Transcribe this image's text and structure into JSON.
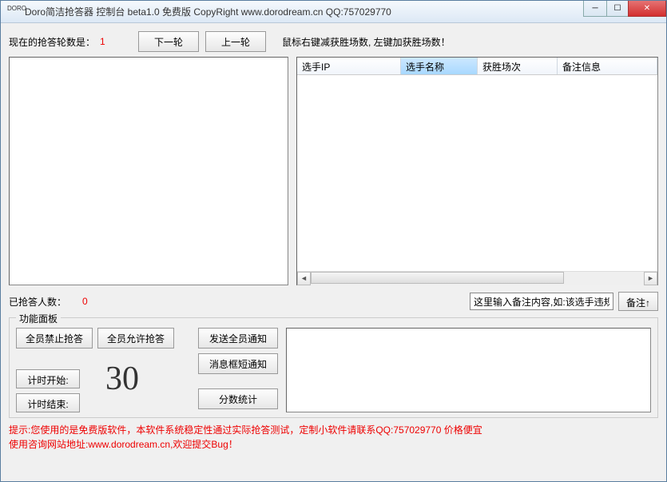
{
  "title": "Doro简洁抢答器 控制台 beta1.0 免费版   CopyRight www.dorodream.cn QQ:757029770",
  "round": {
    "label": "现在的抢答轮数是：",
    "value": "1",
    "next": "下一轮",
    "prev": "上一轮"
  },
  "hint_top": "鼠标右键减获胜场数, 左键加获胜场数！",
  "table": {
    "cols": [
      "选手IP",
      "选手名称",
      "获胜场次",
      "备注信息"
    ]
  },
  "answered": {
    "label": "已抢答人数：",
    "value": "0"
  },
  "remark": {
    "placeholder": "这里输入备注内容,如:该选手违规!",
    "button": "备注↑"
  },
  "panel": {
    "title": "功能面板",
    "forbid": "全员禁止抢答",
    "allow": "全员允许抢答",
    "timer_start": "计时开始:",
    "timer_end": "计时结束:",
    "seconds": "30",
    "send_notice": "发送全员通知",
    "msgbox_notice": "消息框短通知",
    "score_stats": "分数统计"
  },
  "footer": {
    "line1a": "提示:您使用的是免费版软件，本软件系统稳定性通过实际抢答测试，定制小软件请联系QQ:",
    "qq": "757029770",
    "line1b": " 价格便宜",
    "line2a": "使用咨询网站地址:",
    "url": "www.dorodream.cn",
    "line2b": ",欢迎提交Bug！"
  }
}
